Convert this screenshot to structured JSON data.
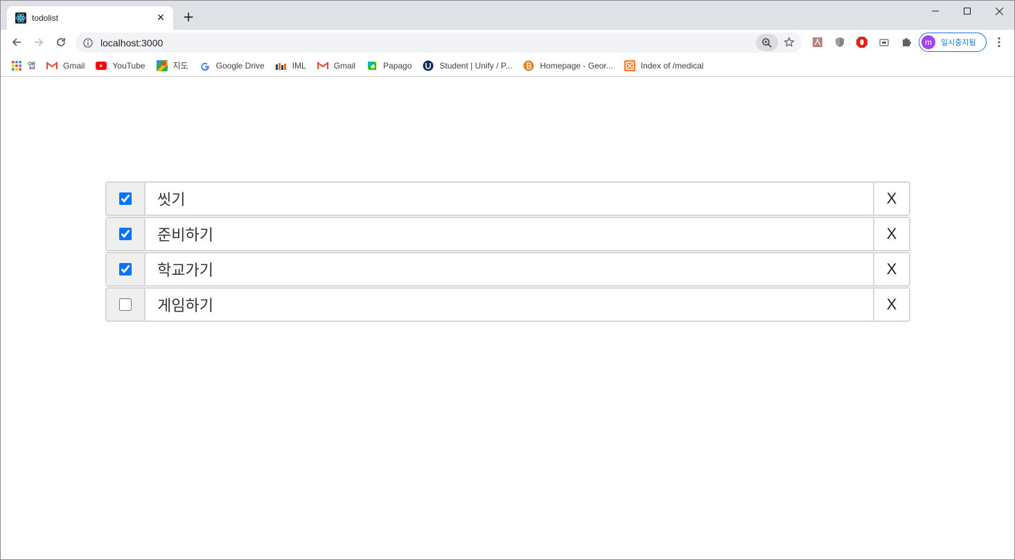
{
  "browser": {
    "tab_title": "todolist",
    "tab_close": "✕",
    "new_tab": "+",
    "url": "localhost:3000",
    "profile_initial": "m",
    "profile_label": "일시중지됨",
    "colors": {
      "accent": "#1a73e8",
      "avatar": "#a142f4",
      "checkbox": "#0075ff"
    }
  },
  "bookmarks": [
    {
      "label": "앱",
      "icon": "apps-grid-icon"
    },
    {
      "label": "Gmail",
      "icon": "gmail-icon"
    },
    {
      "label": "YouTube",
      "icon": "youtube-icon"
    },
    {
      "label": "지도",
      "icon": "maps-icon"
    },
    {
      "label": "Google Drive",
      "icon": "google-icon"
    },
    {
      "label": "IML",
      "icon": "iml-icon"
    },
    {
      "label": "Gmail",
      "icon": "gmail-icon"
    },
    {
      "label": "Papago",
      "icon": "papago-icon"
    },
    {
      "label": "Student | Unify / P...",
      "icon": "unify-icon"
    },
    {
      "label": "Homepage - Geor...",
      "icon": "homepage-icon"
    },
    {
      "label": "Index of /medical",
      "icon": "xampp-icon"
    }
  ],
  "todos": [
    {
      "text": "씻기",
      "done": true,
      "delete_label": "X"
    },
    {
      "text": "준비하기",
      "done": true,
      "delete_label": "X"
    },
    {
      "text": "학교가기",
      "done": true,
      "delete_label": "X"
    },
    {
      "text": "게임하기",
      "done": false,
      "delete_label": "X"
    }
  ]
}
